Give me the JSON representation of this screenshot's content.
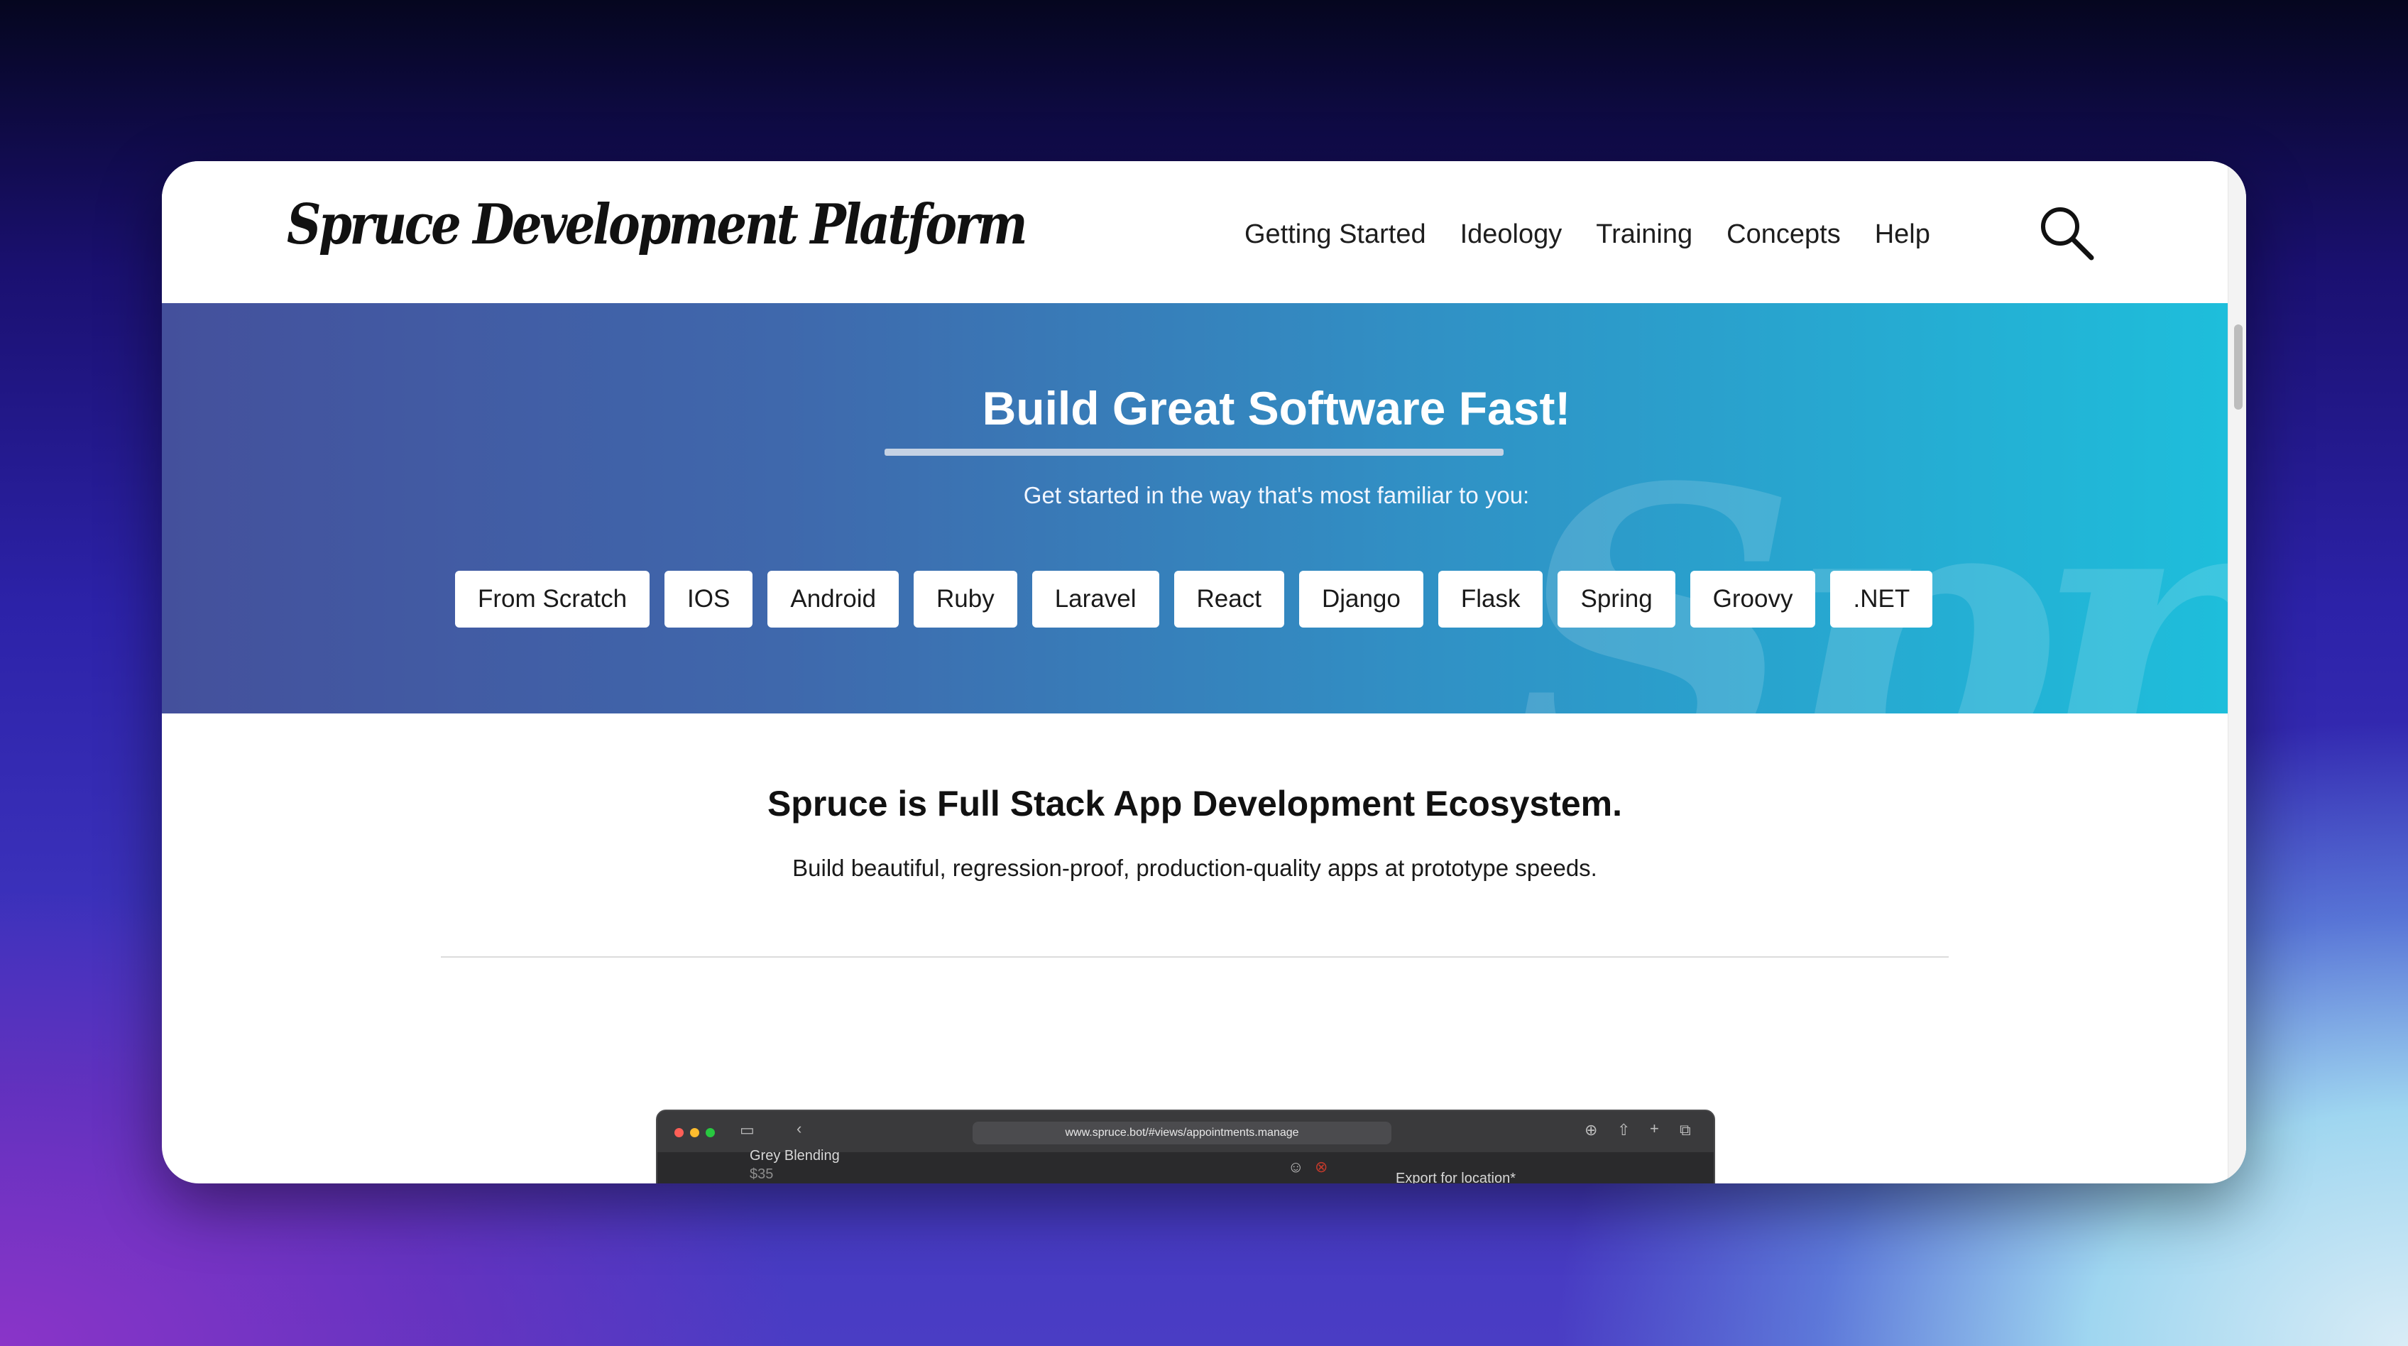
{
  "header": {
    "logo_text": "Spruce Development Platform",
    "nav": [
      "Getting Started",
      "Ideology",
      "Training",
      "Concepts",
      "Help"
    ],
    "search_icon": "search-icon"
  },
  "hero": {
    "title": "Build Great Software Fast!",
    "subtitle": "Get started in the way that's most familiar to you:",
    "watermark": "Spruce",
    "options": [
      "From Scratch",
      "IOS",
      "Android",
      "Ruby",
      "Laravel",
      "React",
      "Django",
      "Flask",
      "Spring",
      "Groovy",
      ".NET"
    ]
  },
  "content": {
    "title": "Spruce is Full Stack App Development Ecosystem.",
    "subtitle": "Build beautiful, regression-proof, production-quality apps at prototype speeds."
  },
  "preview": {
    "url": "www.spruce.bot/#views/appointments.manage",
    "item_name": "Grey Blending",
    "item_price": "$35",
    "export_label": "Export for location*"
  },
  "colors": {
    "hero_gradient_start": "#44509c",
    "hero_gradient_end": "#1ebedb",
    "button_bg": "#ffffff"
  }
}
